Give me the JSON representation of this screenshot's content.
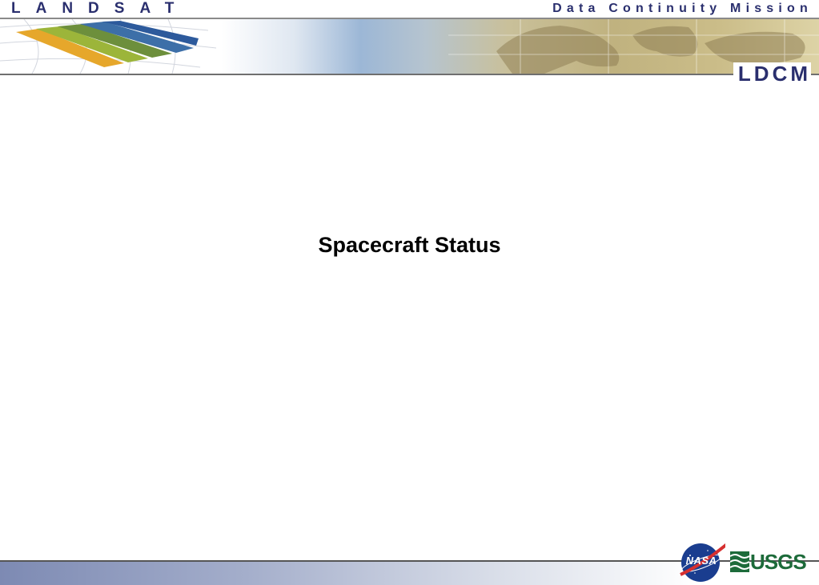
{
  "header": {
    "brand_left": "LANDSAT",
    "brand_right": "Data Continuity Mission",
    "mission_logo": "LDCM"
  },
  "slide": {
    "title": "Spacecraft Status"
  },
  "footer": {
    "nasa_logo_text": "NASA",
    "usgs_logo_text": "USGS"
  },
  "colors": {
    "brand_navy": "#2a2f6e",
    "usgs_green": "#1d6b3a",
    "nasa_blue": "#1a3d8f",
    "nasa_red": "#d62f2f"
  }
}
